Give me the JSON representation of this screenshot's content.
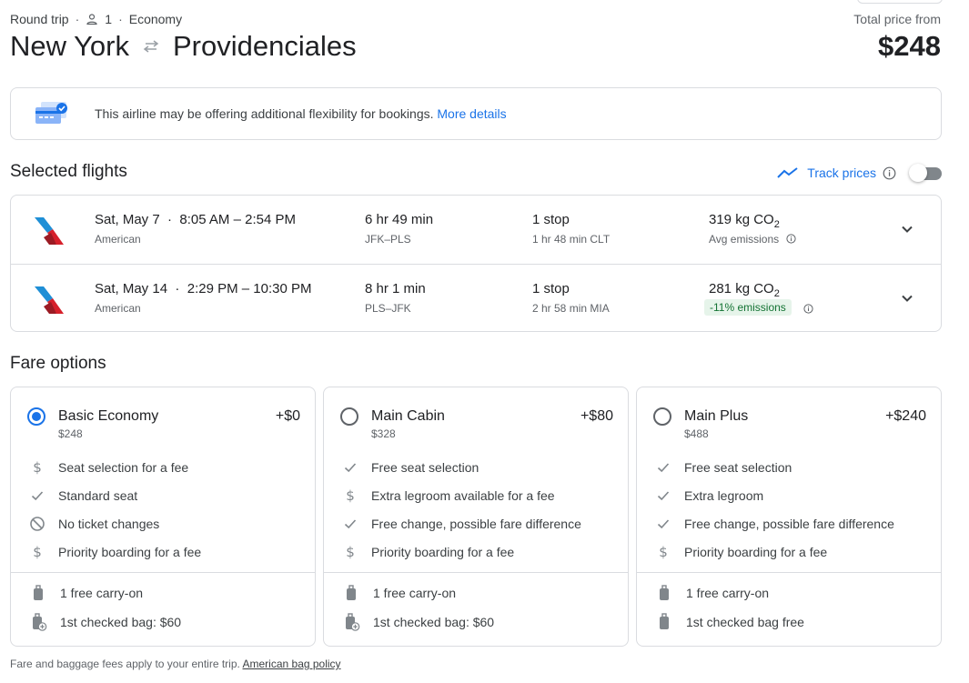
{
  "header": {
    "trip_type": "Round trip",
    "passengers": "1",
    "cabin": "Economy",
    "origin": "New York",
    "destination": "Providenciales",
    "total_label": "Total price from",
    "total_price": "$248"
  },
  "banner": {
    "message": "This airline may be offering additional flexibility for bookings.",
    "link": "More details"
  },
  "selected_flights": {
    "title": "Selected flights",
    "track_label": "Track prices",
    "track_enabled": false,
    "flights": [
      {
        "date": "Sat, May 7",
        "times": "8:05 AM – 2:54 PM",
        "airline": "American",
        "duration": "6 hr 49 min",
        "route": "JFK–PLS",
        "stops": "1 stop",
        "layover": "1 hr 48 min CLT",
        "co2": "319 kg CO",
        "co2_sub": "2",
        "emissions": "Avg emissions"
      },
      {
        "date": "Sat, May 14",
        "times": "2:29 PM – 10:30 PM",
        "airline": "American",
        "duration": "8 hr 1 min",
        "route": "PLS–JFK",
        "stops": "1 stop",
        "layover": "2 hr 58 min MIA",
        "co2": "281 kg CO",
        "co2_sub": "2",
        "emissions": "-11% emissions"
      }
    ]
  },
  "fare_options": {
    "title": "Fare options",
    "cards": [
      {
        "name": "Basic Economy",
        "price": "$248",
        "delta": "+$0",
        "selected": true,
        "features": [
          {
            "icon": "dollar-icon",
            "text": "Seat selection for a fee"
          },
          {
            "icon": "check-icon",
            "text": "Standard seat"
          },
          {
            "icon": "no-icon",
            "text": "No ticket changes"
          },
          {
            "icon": "dollar-icon",
            "text": "Priority boarding for a fee"
          }
        ],
        "carry_on": "1 free carry-on",
        "checked_bag": "1st checked bag: $60"
      },
      {
        "name": "Main Cabin",
        "price": "$328",
        "delta": "+$80",
        "selected": false,
        "features": [
          {
            "icon": "check-icon",
            "text": "Free seat selection"
          },
          {
            "icon": "dollar-icon",
            "text": "Extra legroom available for a fee"
          },
          {
            "icon": "check-icon",
            "text": "Free change, possible fare difference"
          },
          {
            "icon": "dollar-icon",
            "text": "Priority boarding for a fee"
          }
        ],
        "carry_on": "1 free carry-on",
        "checked_bag": "1st checked bag: $60"
      },
      {
        "name": "Main Plus",
        "price": "$488",
        "delta": "+$240",
        "selected": false,
        "features": [
          {
            "icon": "check-icon",
            "text": "Free seat selection"
          },
          {
            "icon": "check-icon",
            "text": "Extra legroom"
          },
          {
            "icon": "check-icon",
            "text": "Free change, possible fare difference"
          },
          {
            "icon": "dollar-icon",
            "text": "Priority boarding for a fee"
          }
        ],
        "carry_on": "1 free carry-on",
        "checked_bag": "1st checked bag free"
      }
    ]
  },
  "footer": {
    "note": "Fare and baggage fees apply to your entire trip.",
    "link": "American bag policy"
  },
  "colors": {
    "accent": "#1a73e8",
    "green": "#137333",
    "green_bg": "#e6f4ea",
    "border": "#dadce0"
  }
}
